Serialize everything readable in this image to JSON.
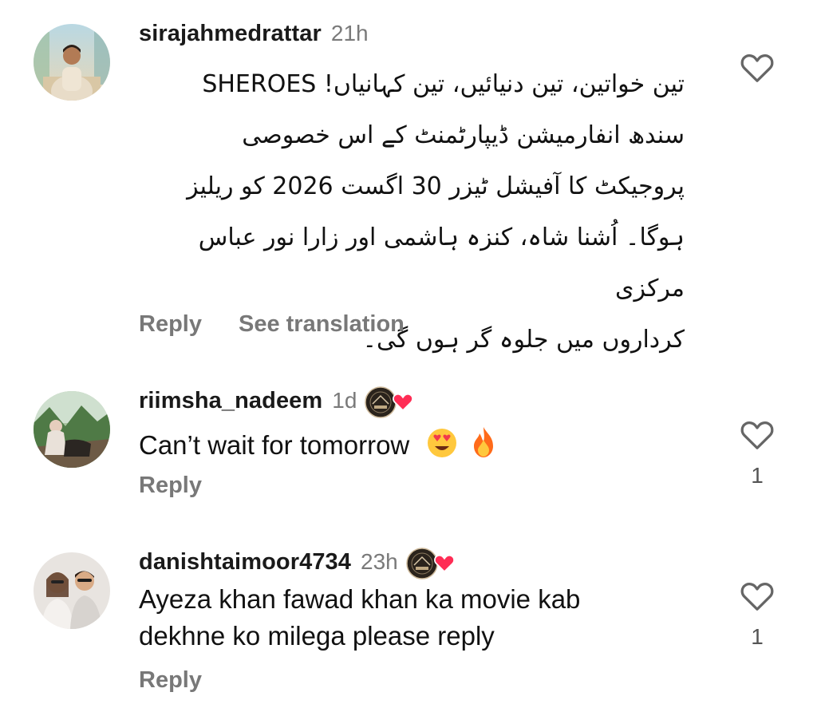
{
  "comments": [
    {
      "username": "sirajahmedrattar",
      "time": "21h",
      "text_lines": [
        "تین خواتین، تین دنیائیں، تین کہانیاں! SHEROES",
        "سندھ انفارمیشن ڈیپارٹمنٹ کے اس خصوصی",
        "پروجیکٹ کا آفیشل ٹیزر 30 اگست 2026 کو ریلیز",
        "ہوگا۔ اُشنا شاہ، کنزہ ہاشمی اور زارا نور عباس مرکزی",
        "کرداروں میں جلوہ گر ہوں گی۔"
      ],
      "reply_label": "Reply",
      "translate_label": "See translation",
      "like_icon": "heart-outline-icon"
    },
    {
      "username": "riimsha_nadeem",
      "time": "1d",
      "creator_liked": true,
      "text": "Can’t wait for tomorrow",
      "emojis": [
        "heart-eyes-emoji",
        "fire-emoji"
      ],
      "reply_label": "Reply",
      "like_count": "1",
      "like_icon": "heart-outline-icon"
    },
    {
      "username": "danishtaimoor4734",
      "time": "23h",
      "creator_liked": true,
      "text_lines": [
        "Ayeza khan fawad khan ka movie kab",
        "dekhne ko milega please reply"
      ],
      "reply_label": "Reply",
      "like_count": "1",
      "like_icon": "heart-outline-icon"
    }
  ],
  "colors": {
    "text": "#111111",
    "muted": "#787878",
    "heart_red": "#ff2d55"
  }
}
